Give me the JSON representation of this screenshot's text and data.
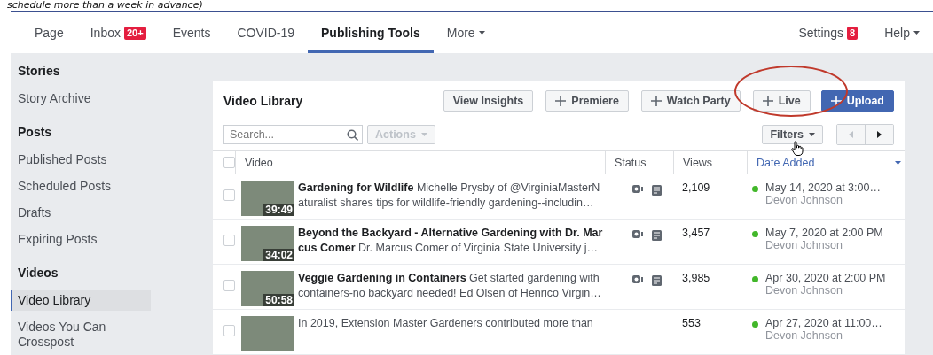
{
  "caption": "schedule more than a week in advance)",
  "nav": {
    "tabs": [
      {
        "label": "Page",
        "selected": false
      },
      {
        "label": "Inbox",
        "selected": false,
        "badge": "20+"
      },
      {
        "label": "Events",
        "selected": false
      },
      {
        "label": "COVID-19",
        "selected": false
      },
      {
        "label": "Publishing Tools",
        "selected": true
      },
      {
        "label": "More",
        "selected": false,
        "dropdown": true
      }
    ],
    "right": [
      {
        "label": "Settings",
        "badge": "8"
      },
      {
        "label": "Help",
        "dropdown": true
      }
    ]
  },
  "sidebar": {
    "sections": [
      {
        "title": "Stories",
        "items": [
          {
            "label": "Story Archive",
            "selected": false
          }
        ]
      },
      {
        "title": "Posts",
        "items": [
          {
            "label": "Published Posts",
            "selected": false
          },
          {
            "label": "Scheduled Posts",
            "selected": false
          },
          {
            "label": "Drafts",
            "selected": false
          },
          {
            "label": "Expiring Posts",
            "selected": false
          }
        ]
      },
      {
        "title": "Videos",
        "items": [
          {
            "label": "Video Library",
            "selected": true
          },
          {
            "label": "Videos You Can Crosspost",
            "selected": false
          }
        ]
      }
    ]
  },
  "panel": {
    "title": "Video Library",
    "buttons": [
      {
        "label": "View Insights",
        "kind": "plain"
      },
      {
        "label": "Premiere",
        "kind": "add"
      },
      {
        "label": "Watch Party",
        "kind": "add"
      },
      {
        "label": "Live",
        "kind": "add"
      },
      {
        "label": "Upload",
        "kind": "primary"
      }
    ],
    "search": {
      "placeholder": "Search..."
    },
    "actions": {
      "label": "Actions",
      "disabled": true
    },
    "filters": {
      "label": "Filters"
    },
    "select_all": {
      "checked": false
    },
    "columns": [
      {
        "label": "Video",
        "sorted": false
      },
      {
        "label": "Status",
        "sorted": false
      },
      {
        "label": "Views",
        "sorted": false
      },
      {
        "label": "Date Added",
        "sorted": true
      }
    ],
    "rows": [
      {
        "text": "**Gardening for Wildlife** Michelle Prysby of @VirginiaMasterNaturalist shares tips for wildlife-friendly gardening--includin…",
        "checked": false,
        "duration": "39:49",
        "status_icons": true,
        "views": "2,109",
        "date": "May 14, 2020 at 3:00…",
        "author": "Devon Johnson",
        "color": "#42b72a"
      },
      {
        "text": "**Beyond the Backyard - Alternative Gardening with Dr. Marcus Comer** Dr. Marcus Comer of Virginia State University j…",
        "checked": false,
        "duration": "34:02",
        "status_icons": true,
        "views": "3,457",
        "date": "May 7, 2020 at 2:00 PM",
        "author": "Devon Johnson",
        "color": "#42b72a"
      },
      {
        "text": "**Veggie Gardening in Containers** Get started gardening with containers-no backyard needed! Ed Olsen of Henrico Virgin…",
        "checked": false,
        "duration": "50:58",
        "status_icons": true,
        "views": "3,985",
        "date": "Apr 30, 2020 at 2:00 PM",
        "author": "Devon Johnson",
        "color": "#42b72a"
      },
      {
        "text": "In 2019, Extension Master Gardeners contributed more than",
        "checked": false,
        "status_icons": false,
        "views": "553",
        "date": "Apr 27, 2020 at 11:00…",
        "author": "Devon Johnson",
        "color": "#42b72a"
      }
    ]
  }
}
